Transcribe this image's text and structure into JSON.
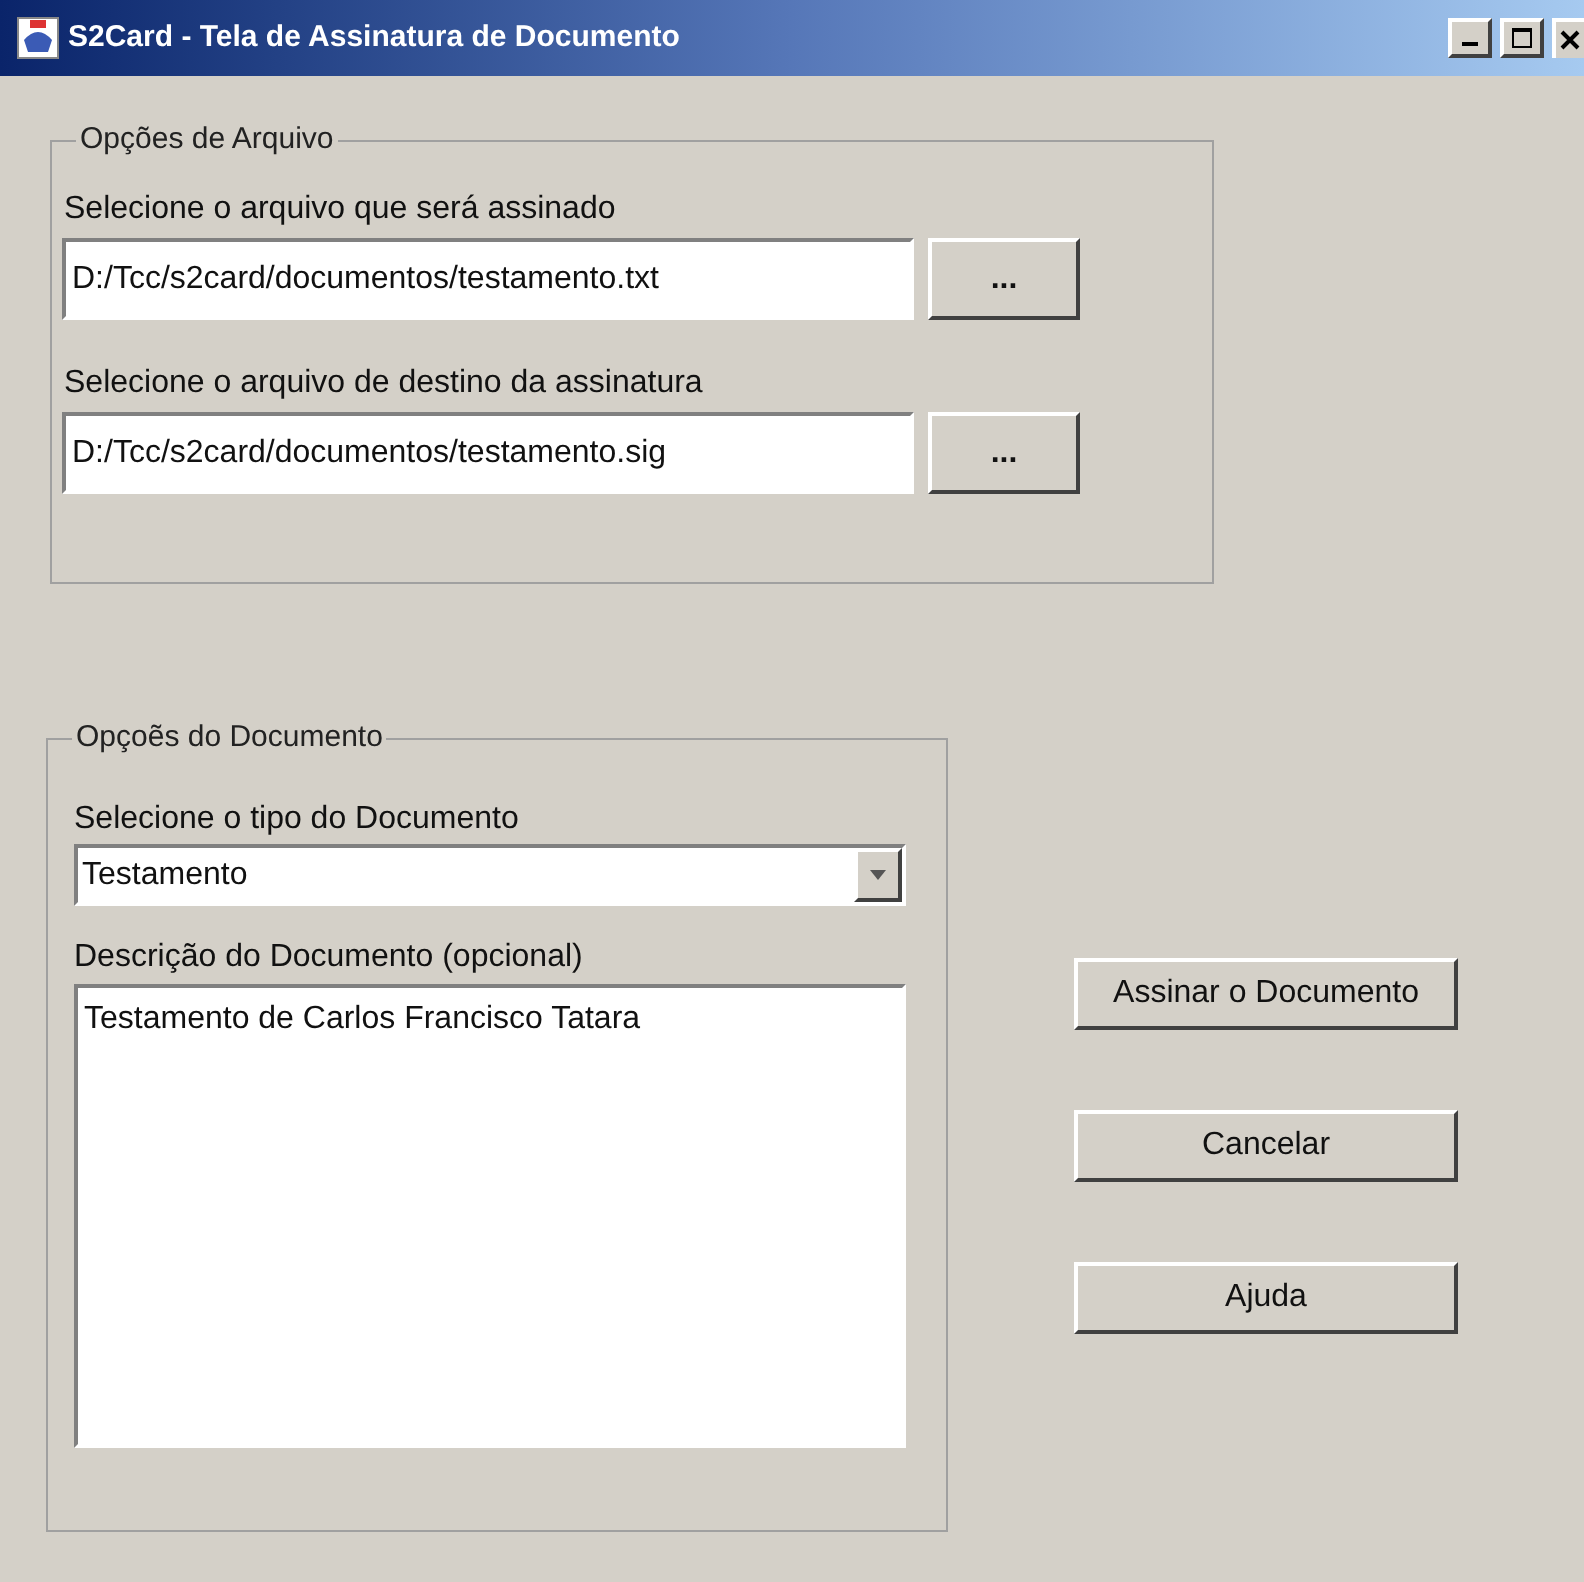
{
  "window": {
    "title": "S2Card - Tela de Assinatura de Documento"
  },
  "file_options": {
    "legend": "Opções de Arquivo",
    "fields": [
      {
        "label": "Selecione o arquivo que será assinado",
        "value": "D:/Tcc/s2card/documentos/testamento.txt",
        "browse_label": "..."
      },
      {
        "label": "Selecione o arquivo de destino da assinatura",
        "value": "D:/Tcc/s2card/documentos/testamento.sig",
        "browse_label": "..."
      }
    ]
  },
  "document_options": {
    "legend": "Opçoẽs do Documento",
    "type_label": "Selecione o tipo do Documento",
    "type_value": "Testamento",
    "description_label": "Descrição do Documento (opcional)",
    "description_value": "Testamento de Carlos Francisco Tatara"
  },
  "buttons": [
    "Assinar o Documento",
    "Cancelar",
    "Ajuda"
  ]
}
